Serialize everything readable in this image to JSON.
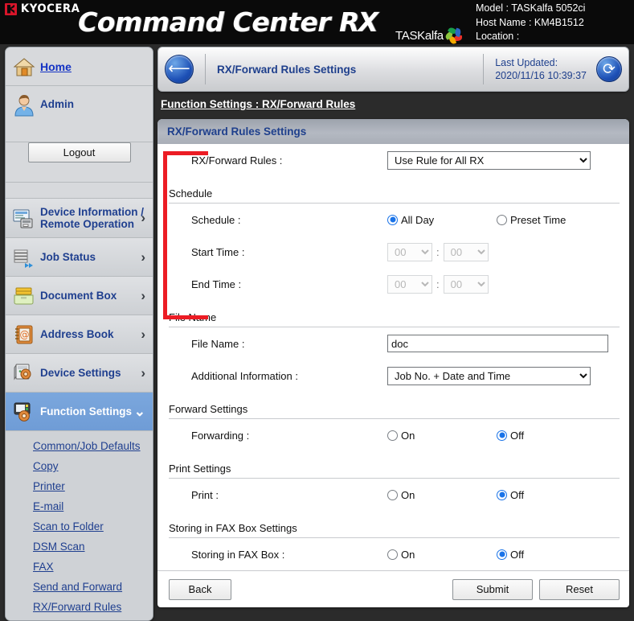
{
  "banner": {
    "brand": "KYOCERA",
    "product_title": "Command Center RX",
    "sub_logo": "TASKalfa",
    "model_line": "Model : TASKalfa 5052ci",
    "host_line": "Host Name : KM4B1512",
    "location_line": "Location :"
  },
  "sidebar": {
    "home": "Home",
    "user": "Admin",
    "logout_label": "Logout",
    "items": [
      {
        "label_line1": "Device Information /",
        "label_line2": "Remote Operation",
        "icon": "device-info-icon",
        "chevron": "›",
        "active": false
      },
      {
        "label_line1": "Job Status",
        "label_line2": "",
        "icon": "job-status-icon",
        "chevron": "›",
        "active": false
      },
      {
        "label_line1": "Document Box",
        "label_line2": "",
        "icon": "document-box-icon",
        "chevron": "›",
        "active": false
      },
      {
        "label_line1": "Address Book",
        "label_line2": "",
        "icon": "address-book-icon",
        "chevron": "›",
        "active": false
      },
      {
        "label_line1": "Device Settings",
        "label_line2": "",
        "icon": "device-settings-icon",
        "chevron": "›",
        "active": false
      },
      {
        "label_line1": "Function Settings",
        "label_line2": "",
        "icon": "function-settings-icon",
        "chevron": "⌄",
        "active": true
      }
    ],
    "submenu": [
      "Common/Job Defaults",
      "Copy",
      "Printer",
      "E-mail",
      "Scan to Folder",
      "DSM Scan",
      "FAX",
      "Send and Forward",
      "RX/Forward Rules"
    ]
  },
  "topbar": {
    "back_icon": "back-arrow-icon",
    "page_title": "RX/Forward Rules Settings",
    "last_updated_label": "Last Updated:",
    "last_updated_value": "2020/11/16 10:39:37",
    "refresh_icon": "refresh-icon"
  },
  "breadcrumb": "Function Settings : RX/Forward Rules",
  "panel": {
    "header": "RX/Forward Rules Settings",
    "fields": {
      "rx_forward_rules_label": "RX/Forward Rules :",
      "rx_forward_rules_value": "Use Rule for All RX",
      "rx_forward_rules_options": [
        "Use Rule for All RX"
      ],
      "schedule_section": "Schedule",
      "schedule_label": "Schedule :",
      "schedule_opt_allday": "All Day",
      "schedule_opt_preset": "Preset Time",
      "schedule_selected": "All Day",
      "start_time_label": "Start Time :",
      "start_time_hour": "00",
      "start_time_minute": "00",
      "end_time_label": "End Time :",
      "end_time_hour": "00",
      "end_time_minute": "00",
      "time_separator": ":",
      "file_name_section": "File Name",
      "file_name_label": "File Name :",
      "file_name_value": "doc",
      "additional_info_label": "Additional Information :",
      "additional_info_value": "Job No. + Date and Time",
      "additional_info_options": [
        "Job No. + Date and Time"
      ],
      "forward_section": "Forward Settings",
      "forwarding_label": "Forwarding :",
      "forwarding_on": "On",
      "forwarding_off": "Off",
      "forwarding_selected": "Off",
      "print_section": "Print Settings",
      "print_label": "Print :",
      "print_on": "On",
      "print_off": "Off",
      "print_selected": "Off",
      "fax_box_section": "Storing in FAX Box Settings",
      "fax_box_label": "Storing in FAX Box :",
      "fax_box_on": "On",
      "fax_box_off": "Off",
      "fax_box_selected": "Off"
    },
    "buttons": {
      "back": "Back",
      "submit": "Submit",
      "reset": "Reset"
    }
  },
  "annotation": {
    "type": "red-highlight-rectangle",
    "color": "#ec1c24"
  },
  "colors": {
    "banner_bg": "#0a0a0a",
    "page_bg": "#2b2b2b",
    "brand_red": "#d8152a",
    "link_blue": "#1f3f8f",
    "active_nav": "#6f9cd6",
    "radio_accent": "#1a73e8"
  }
}
